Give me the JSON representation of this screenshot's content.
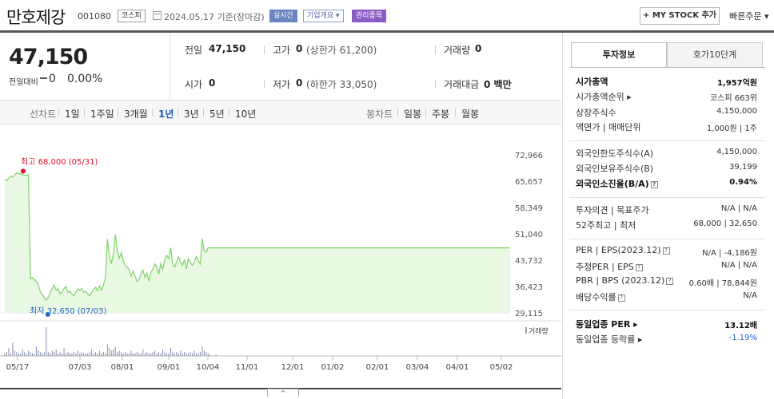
{
  "header": {
    "name": "만호제강",
    "code": "001080",
    "market": "코스피",
    "date": "2024.05.17  기준(장마감)",
    "tags": [
      "실시간",
      "기업개요 ▾",
      "관리종목"
    ],
    "my_stock": "+ MY STOCK 추가",
    "fast_order": "빠른주문 ▾"
  },
  "price": {
    "current": "47,150",
    "change_label": "전일대비",
    "change": "0",
    "change_pct": "0.00%"
  },
  "summary": {
    "prev_close_label": "전일",
    "prev_close": "47,150",
    "high_label": "고가",
    "high": "0",
    "upper_limit": "(상한가 61,200)",
    "volume_label": "거래량",
    "volume": "0",
    "open_label": "시가",
    "open": "0",
    "low_label": "저가",
    "low": "0",
    "lower_limit": "(하한가 33,050)",
    "trade_value_label": "거래대금",
    "trade_value": "0 백만"
  },
  "periods": {
    "line_label": "선차트",
    "line_items": [
      "1일",
      "1주일",
      "3개월",
      "1년",
      "3년",
      "5년",
      "10년"
    ],
    "selected": "1년",
    "candle_label": "봉차트",
    "candle_items": [
      "일봉",
      "주봉",
      "월봉"
    ]
  },
  "chart_data": {
    "type": "area",
    "y_ticks": [
      "72,966",
      "65,657",
      "58,349",
      "51,040",
      "43,732",
      "36,423",
      "29,115"
    ],
    "ylim": [
      29115,
      72966
    ],
    "x_ticks": [
      "05/17",
      "07/03",
      "08/01",
      "09/01",
      "10/04",
      "11/01",
      "12/01",
      "01/02",
      "02/01",
      "03/04",
      "04/01",
      "05/02"
    ],
    "high_label": "최고 68,000 (05/31)",
    "low_label": "최저 32,650 (07/03)",
    "volume_label": "거래량",
    "series": [
      {
        "values": [
          66200,
          65800,
          66500,
          67100,
          66700,
          67400,
          68000,
          67600,
          67800,
          67500,
          67300,
          67200,
          67400,
          38500,
          38900,
          38300,
          37800,
          36800,
          34900,
          34200,
          33300,
          32650,
          33400,
          34700,
          35900,
          36900,
          35400,
          35800,
          34400,
          34900,
          35900,
          36400,
          34700,
          35200,
          34400,
          33800,
          34900,
          35800,
          35300,
          35900,
          34800,
          35100,
          34400,
          33900,
          34800,
          35600,
          36200,
          35200,
          36600,
          35400,
          36900,
          38900,
          49600,
          44700,
          42800,
          45300,
          50800,
          46300,
          44300,
          45800,
          43600,
          42300,
          41800,
          41100,
          39300,
          40700,
          39300,
          37800,
          38400,
          39900,
          40900,
          38900,
          40200,
          37900,
          40300,
          41300,
          42700,
          41800,
          39800,
          42800,
          41200,
          43800,
          45100,
          44200,
          47200,
          42900,
          41800,
          43200,
          44700,
          43300,
          42300,
          43800,
          41300,
          44100,
          43100,
          42300,
          43200,
          44800,
          43700,
          42700,
          49700,
          46300,
          45900,
          47150,
          47150,
          47150,
          47150,
          47150,
          47150,
          47150,
          47150,
          47150,
          47150,
          47150,
          47150,
          47150,
          47150,
          47150,
          47150,
          47150,
          47150,
          47150,
          47150,
          47150,
          47150,
          47150,
          47150,
          47150,
          47150,
          47150,
          47150,
          47150,
          47150,
          47150,
          47150,
          47150,
          47150,
          47150,
          47150,
          47150,
          47150,
          47150,
          47150,
          47150,
          47150,
          47150,
          47150,
          47150,
          47150,
          47150,
          47150,
          47150,
          47150,
          47150,
          47150,
          47150,
          47150,
          47150,
          47150,
          47150,
          47150,
          47150,
          47150,
          47150,
          47150,
          47150,
          47150,
          47150,
          47150,
          47150,
          47150,
          47150,
          47150,
          47150,
          47150,
          47150,
          47150,
          47150,
          47150,
          47150,
          47150,
          47150,
          47150,
          47150,
          47150,
          47150,
          47150,
          47150,
          47150,
          47150,
          47150,
          47150,
          47150,
          47150,
          47150,
          47150,
          47150,
          47150,
          47150,
          47150,
          47150,
          47150,
          47150,
          47150,
          47150,
          47150,
          47150,
          47150,
          47150,
          47150,
          47150,
          47150,
          47150,
          47150,
          47150,
          47150,
          47150,
          47150,
          47150,
          47150,
          47150,
          47150,
          47150,
          47150,
          47150,
          47150,
          47150,
          47150,
          47150,
          47150,
          47150,
          47150,
          47150,
          47150,
          47150,
          47150,
          47150,
          47150,
          47150,
          47150,
          47150,
          47150,
          47150,
          47150,
          47150,
          47150,
          47150,
          47150,
          47150,
          47150,
          47150,
          47150,
          47150,
          47150,
          47150,
          47150,
          47150
        ]
      }
    ],
    "volume_values": [
      2,
      3,
      6,
      2,
      10,
      4,
      3,
      2,
      2,
      5,
      3,
      2,
      4,
      3,
      2,
      2,
      7,
      4,
      3,
      2,
      3,
      22,
      3,
      2,
      4,
      3,
      5,
      2,
      3,
      2,
      6,
      2,
      3,
      2,
      2,
      3,
      2,
      4,
      2,
      3,
      2,
      2,
      2,
      3,
      5,
      2,
      3,
      2,
      4,
      2,
      3,
      2,
      9,
      6,
      4,
      5,
      7,
      3,
      4,
      3,
      2,
      3,
      2,
      2,
      4,
      2,
      2,
      3,
      2,
      2,
      5,
      2,
      3,
      2,
      2,
      3,
      4,
      2,
      3,
      2,
      5,
      3,
      2,
      2,
      6,
      3,
      2,
      3,
      2,
      4,
      2,
      3,
      2,
      2,
      3,
      2,
      4,
      2,
      2,
      3,
      7,
      4,
      3,
      2,
      1,
      0,
      0,
      1,
      0,
      0,
      0,
      0,
      0,
      0,
      0,
      0,
      0,
      0,
      0,
      0,
      0,
      0,
      0,
      0,
      0,
      0,
      0,
      0,
      0,
      0,
      0,
      0,
      0,
      0,
      0,
      0,
      0,
      0,
      0,
      0,
      0,
      0,
      0,
      0,
      0,
      0,
      0,
      0,
      0,
      0,
      0,
      0,
      0,
      0,
      0,
      0,
      0,
      0,
      0,
      0,
      0,
      0,
      0,
      0,
      0,
      0,
      0,
      0,
      0,
      0,
      0,
      0,
      0,
      0,
      0,
      0,
      0,
      0,
      0,
      0,
      0,
      0,
      0,
      0,
      0,
      0,
      0,
      0,
      0,
      0,
      0,
      0,
      0,
      0,
      0,
      0,
      0,
      0,
      0,
      0,
      0,
      0,
      0,
      0,
      0,
      0,
      0,
      0,
      0,
      0,
      0,
      0,
      0,
      0,
      0,
      0,
      0,
      0,
      0,
      0,
      0,
      0,
      0,
      0,
      0,
      0,
      0,
      0,
      0,
      0,
      0,
      0,
      0,
      0,
      0,
      0,
      0,
      0,
      0,
      0,
      0,
      0,
      0,
      0,
      0,
      0,
      0,
      0,
      0,
      0,
      0,
      0,
      0,
      0,
      0,
      0,
      0,
      0,
      0,
      0,
      0,
      0,
      0,
      0,
      0,
      0,
      0,
      0
    ],
    "line_color": "#7fd36b",
    "fill_color": "#e9f8e3",
    "high_color": "#e0102a",
    "low_color": "#2466c7"
  },
  "invest_tabs": [
    "투자정보",
    "호가10단계"
  ],
  "invest": {
    "rows": [
      {
        "label": "시가총액",
        "value": "1,957억원",
        "bold": true
      },
      {
        "label": "시가총액순위 ▸",
        "value": "코스피 663위"
      },
      {
        "label": "상장주식수",
        "value": "4,150,000"
      },
      {
        "label": "액면가 | 매매단위",
        "value": "1,000원 | 1주"
      },
      {
        "label": "외국인한도주식수(A)",
        "value": "4,150,000"
      },
      {
        "label": "외국인보유주식수(B)",
        "value": "39,199"
      },
      {
        "label": "외국인소진율(B/A)",
        "value": "0.94%",
        "bold": true,
        "help": true
      },
      {
        "label": "투자의견 | 목표주가",
        "value": "N/A | N/A"
      },
      {
        "label": "52주최고 | 최저",
        "value": "68,000 | 32,650"
      },
      {
        "label": "PER | EPS(2023.12)",
        "value": "N/A | -4,186원",
        "help": true
      },
      {
        "label": "추정PER | EPS",
        "value": "N/A | N/A",
        "help": true
      },
      {
        "label": "PBR | BPS (2023.12)",
        "value": "0.60배 | 78,844원",
        "help": true
      },
      {
        "label": "배당수익률",
        "value": "N/A",
        "help": true
      },
      {
        "label": "동일업종 PER ▸",
        "value": "13.12배",
        "bold": true
      },
      {
        "label": "동일업종 등락률 ▸",
        "value": "-1.19%",
        "blue": true
      }
    ]
  },
  "scroll": "^"
}
